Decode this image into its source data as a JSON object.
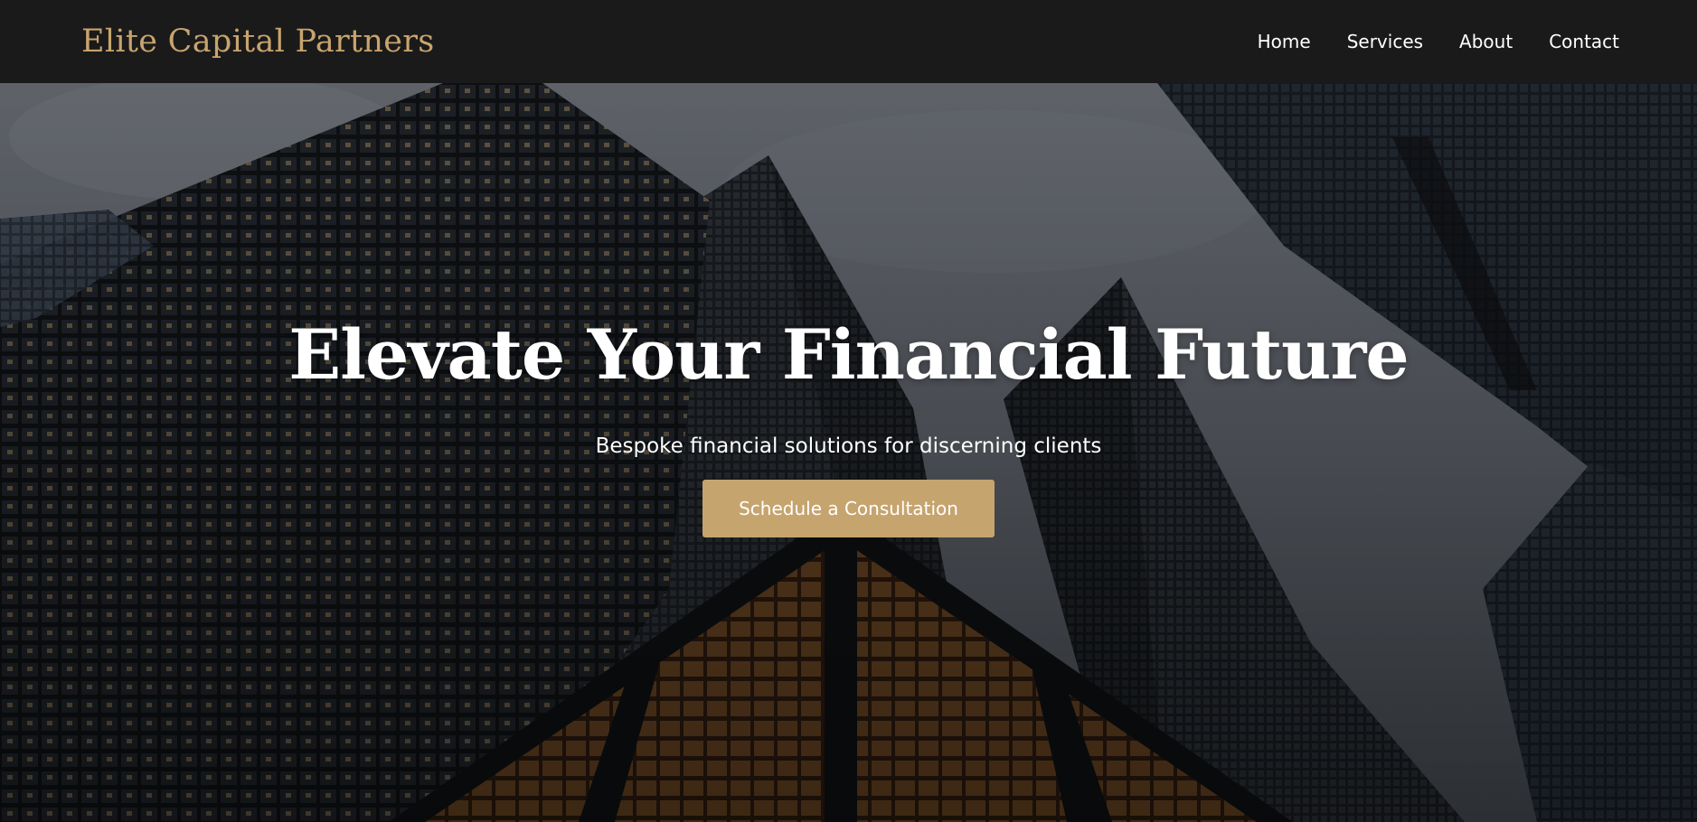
{
  "header": {
    "brand": "Elite Capital Partners",
    "nav": [
      {
        "label": "Home"
      },
      {
        "label": "Services"
      },
      {
        "label": "About"
      },
      {
        "label": "Contact"
      }
    ]
  },
  "hero": {
    "title": "Elevate Your Financial Future",
    "subtitle": "Bespoke financial solutions for discerning clients",
    "cta_label": "Schedule a Consultation"
  },
  "colors": {
    "navbar_bg": "#1a1a1a",
    "brand_gold": "#c8a46e",
    "button_gold": "#c6a46e",
    "text_white": "#ffffff"
  }
}
